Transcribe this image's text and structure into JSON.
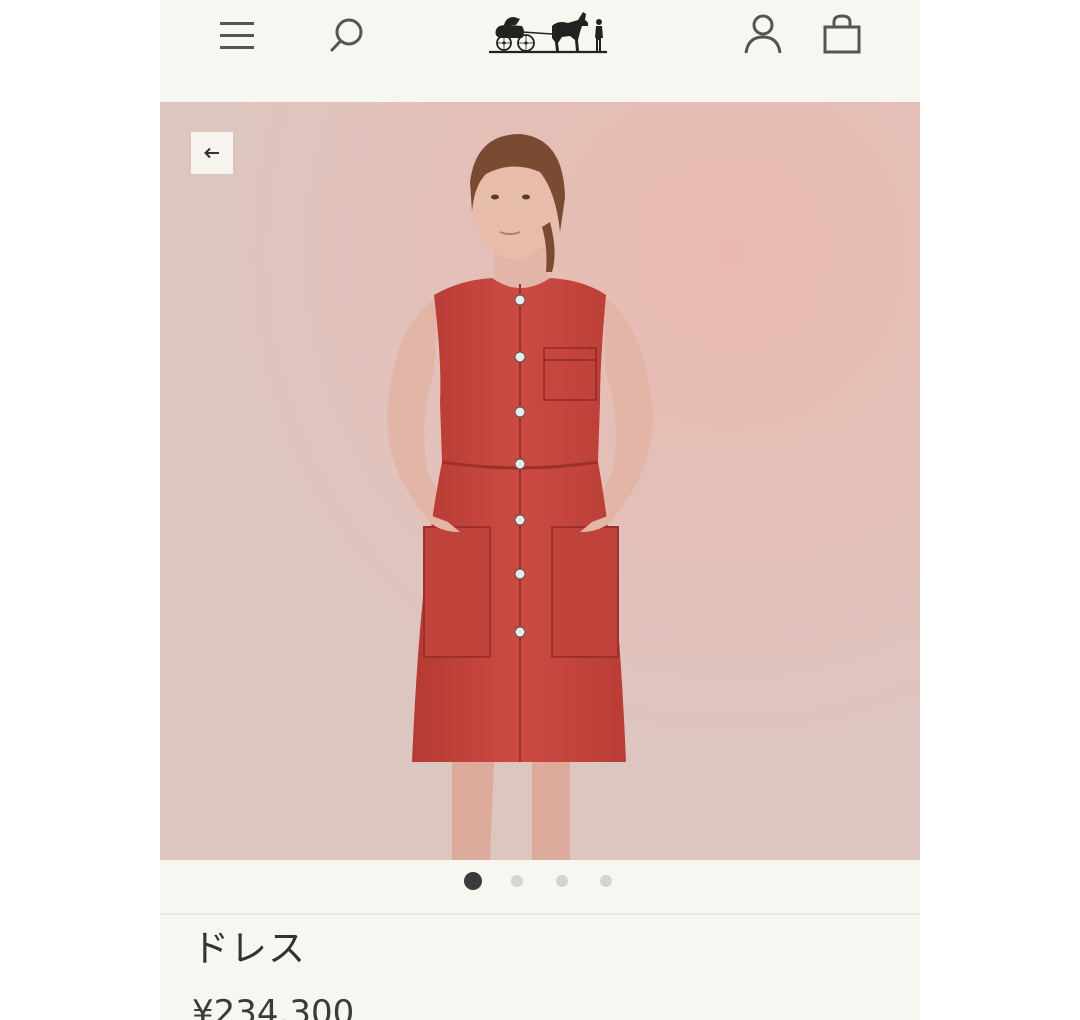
{
  "header": {
    "menu_icon": "hamburger-menu-icon",
    "search_icon": "search-icon",
    "logo": "horse-carriage-logo",
    "account_icon": "account-icon",
    "bag_icon": "shopping-bag-icon"
  },
  "gallery": {
    "back_icon": "arrow-left-icon",
    "back_label": "←",
    "slide_count": 4,
    "active_slide": 1
  },
  "product": {
    "name": "ドレス",
    "price": "¥234,300"
  },
  "colors": {
    "background": "#f8f6f0",
    "photo_backdrop": "#e1c5bf",
    "dress": "#c8473f",
    "dot_active": "#3b3b3b",
    "dot_inactive": "#d6d4cf"
  }
}
